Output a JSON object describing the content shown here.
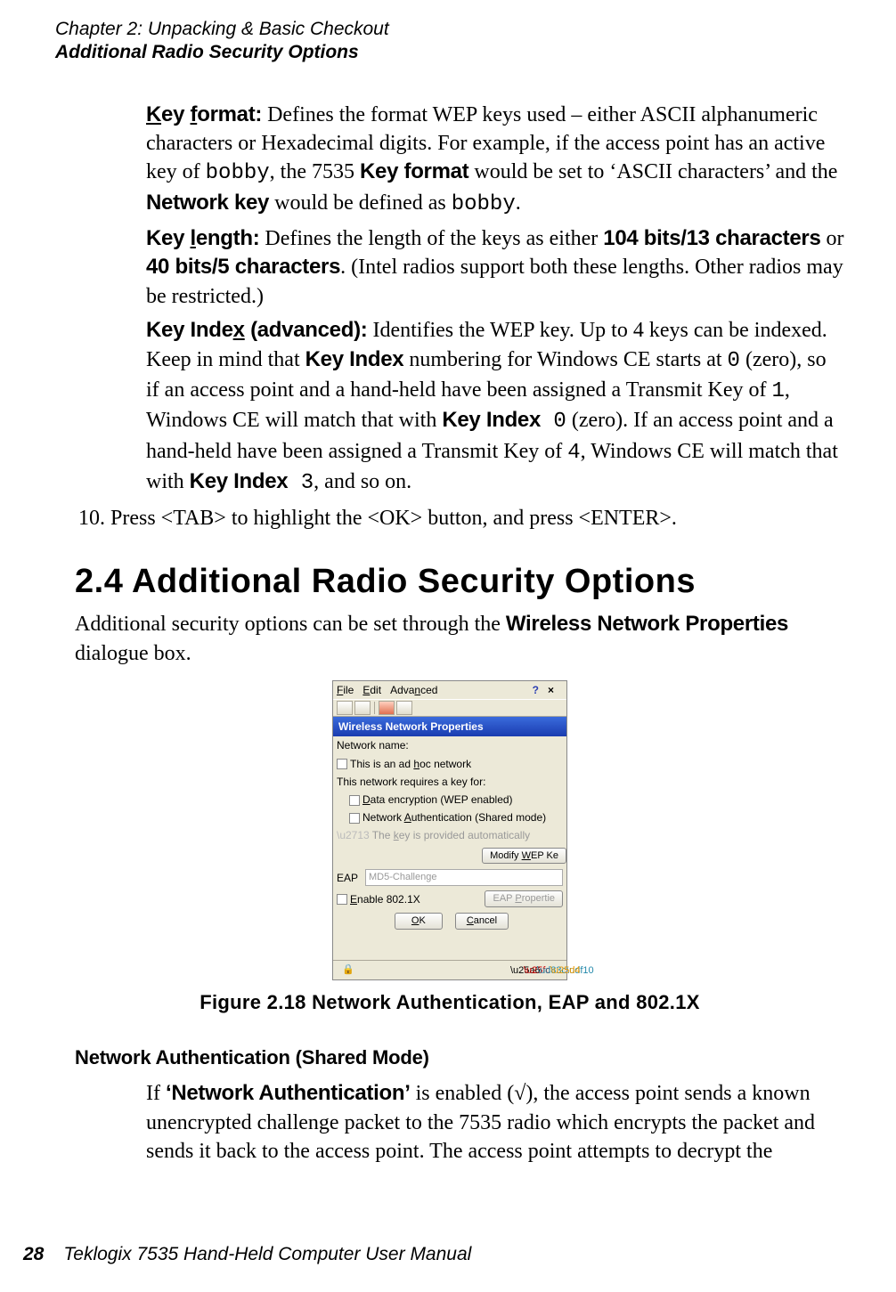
{
  "header": {
    "chapter_line": "Chapter 2: Unpacking & Basic Checkout",
    "section_line": "Additional Radio Security Options"
  },
  "definitions": {
    "key_format_label": "Key format:",
    "key_format_text_1": " Defines the format WEP keys used – either ASCII alphanumeric characters or Hexadecimal digits. For example, if the access point has an active key of ",
    "bobby1": "bobby",
    "key_format_text_2": ", the 7535 ",
    "key_format_label2": "Key format",
    "key_format_text_3": " would be set to ‘ASCII characters’ and the ",
    "network_key_label": "Network key",
    "key_format_text_4": " would be defined as ",
    "bobby2": "bobby",
    "period": ".",
    "key_length_label": "Key length:",
    "key_length_text_1": " Defines the length of the keys as either ",
    "kl_opt1": "104 bits/13 characters",
    "kl_or": " or ",
    "kl_opt2": "40 bits/5 characters",
    "key_length_text_2": ". (Intel radios support both these lengths. Other radios may be restricted.)",
    "key_index_label": "Key Index (advanced):",
    "key_index_text_1": " Identifies the WEP key. Up to 4 keys can be indexed. Keep in mind that ",
    "key_index_label2": "Key Index",
    "key_index_text_2": " numbering for Windows CE starts at ",
    "zero1": "0",
    "key_index_text_3": " (zero), so if an access point and a hand-held have been assigned a Transmit Key of ",
    "one": "1",
    "key_index_text_4": ", Windows CE will match that with ",
    "key_index_label3": "Key Index",
    "space_zero": " 0",
    "key_index_text_5": " (zero). If an access point and a hand-held have been assigned a Transmit Key of ",
    "four": "4",
    "key_index_text_6": ", Windows CE will match that with ",
    "key_index_label4": "Key Index",
    "three": " 3",
    "key_index_text_7": ", and so on."
  },
  "step10": {
    "num": "10. ",
    "text": "Press <TAB> to highlight the <OK> button, and press <ENTER>."
  },
  "section24": {
    "title": "2.4  Additional Radio Security Options",
    "intro_1": "Additional security options can be set through the ",
    "intro_bold": "Wireless Network Properties",
    "intro_2": " dialogue box."
  },
  "figure": {
    "caption": "Figure 2.18 Network Authentication, EAP and 802.1X",
    "menu_file": "File",
    "menu_edit": "Edit",
    "menu_advanced": "Advanced",
    "menu_help": "?",
    "menu_close": "×",
    "titlebar": "Wireless Network Properties",
    "net_name_label": "Network name:",
    "adhoc_label": "This is an ad hoc network",
    "requires_key": "This network requires a key for:",
    "wep_label": "Data encryption (WEP enabled)",
    "auth_label": "Network Authentication (Shared mode)",
    "key_auto": "The key is provided automatically",
    "modify_wep": "Modify WEP Ke",
    "eap_label": "EAP",
    "eap_value": "MD5-Challenge",
    "enable_8021x": "Enable 802.1X",
    "eap_props": "EAP Propertie",
    "ok": "OK",
    "cancel": "Cancel",
    "lock": "🔒"
  },
  "subsection": {
    "heading": "Network Authentication (Shared Mode)",
    "body_1": "If ",
    "body_bold": "‘Network Authentication’",
    "body_2": " is enabled (√), the access point sends a known unencrypted challenge packet to the 7535 radio which encrypts the packet and sends it back to the access point. The access point attempts to decrypt the"
  },
  "footer": {
    "page": "28",
    "text": "Teklogix 7535 Hand-Held Computer User Manual"
  }
}
